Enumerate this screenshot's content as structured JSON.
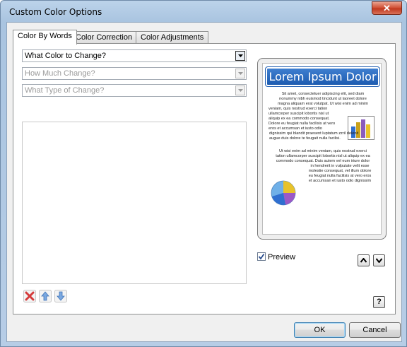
{
  "window": {
    "title": "Custom Color Options",
    "close_glyph": "✕"
  },
  "tabs": [
    {
      "label": "Color By Words",
      "active": true
    },
    {
      "label": "Color Correction",
      "active": false
    },
    {
      "label": "Color Adjustments",
      "active": false
    }
  ],
  "combos": {
    "what_color": {
      "value": "What Color to Change?",
      "enabled": true
    },
    "how_much": {
      "value": "How Much Change?",
      "enabled": false
    },
    "change_type": {
      "value": "What Type of Change?",
      "enabled": false
    }
  },
  "list_actions": {
    "delete_icon": "delete-x-icon",
    "up_icon": "arrow-up-icon",
    "down_icon": "arrow-down-icon"
  },
  "preview": {
    "heading": "Lorem Ipsum Dolor",
    "para1_lines": [
      "Sit amet, consectetuer adipiscing elit, sed diam",
      "nonummy nibh euismod tincidunt ut laoreet dolore",
      "magna aliquam erat volutpat. Ut wisi enim ad minim",
      "veniam, quis nostrud exerci tation",
      "ullamcorper suscipit lobortis nisl ut",
      "aliquip ex ea commodo consequat.",
      "Dolore eu feugiat nulla facilisis at vero",
      "eros et accumsan et iusto odio",
      "dignissim qui blandit praesent luptatum zzril delenit",
      "augue duis dolore te feugait nulla facilisi."
    ],
    "para2_lines": [
      "Ut wisi enim ad minim veniam, quis nostrud exerci",
      "tation ullamcorper suscipit lobortis nisl ut aliquip ex ea",
      "commodo consequat. Duis autem vel eum iriure dolor",
      "in hendrerit in vulputate velit esse",
      "molestie consequat, vel illum dolore",
      "eu feugiat nulla facilisis at vero eros",
      "et accumsan et iusto odio dignissim"
    ],
    "bar_colors": [
      "#2f6fd0",
      "#c9a21c",
      "#8a5bbd",
      "#e8c22a"
    ],
    "pie_colors": [
      "#2f6fd0",
      "#e8c22a",
      "#9b59c6",
      "#6fb0e8"
    ],
    "checkbox_label": "Preview",
    "checked": true,
    "up_glyph": "^",
    "down_glyph": "v"
  },
  "help_label": "?",
  "buttons": {
    "ok": "OK",
    "cancel": "Cancel"
  },
  "colors": {
    "accent": "#1d5bb0",
    "close": "#c0391f",
    "delete": "#d43b3b",
    "arrows": "#5b8fd6"
  }
}
